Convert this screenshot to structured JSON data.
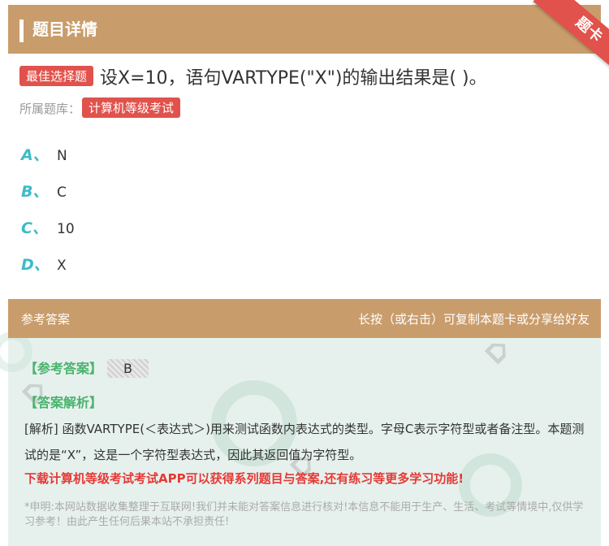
{
  "header": {
    "title": "题目详情",
    "ribbon": "题卡"
  },
  "question": {
    "tag": "最佳选择题",
    "text": "设X=10，语句VARTYPE(\"X\")的输出结果是( )。",
    "bank_label": "所属题库：",
    "bank_tag": "计算机等级考试"
  },
  "options": [
    {
      "letter": "A、",
      "text": "N"
    },
    {
      "letter": "B、",
      "text": "C"
    },
    {
      "letter": "C、",
      "text": "10"
    },
    {
      "letter": "D、",
      "text": "X"
    }
  ],
  "answer": {
    "bar_left": "参考答案",
    "bar_right": "长按（或右击）可复制本题卡或分享给好友",
    "ref_label": "【参考答案】",
    "ref_value": "B",
    "analysis_label": "【答案解析】",
    "analysis_text": "[解析] 函数VARTYPE(＜表达式＞)用来测试函数内表达式的类型。字母C表示字符型或者备注型。本题测试的是“X”，这是一个字符型表达式，因此其返回值为字符型。",
    "download": "下载计算机等级考试考试APP可以获得系列题目与答案,还有练习等更多学习功能!",
    "disclaimer": "*申明:本网站数据收集整理于互联网!我们并未能对答案信息进行核对!本信息不能用于生产、生活、考试等情境中,仅供学习参考！由此产生任何后果本站不承担责任!"
  },
  "colors": {
    "brown": "#c99c6b",
    "red": "#e0524b",
    "teal": "#3bbcc8",
    "green": "#4ab36d"
  }
}
